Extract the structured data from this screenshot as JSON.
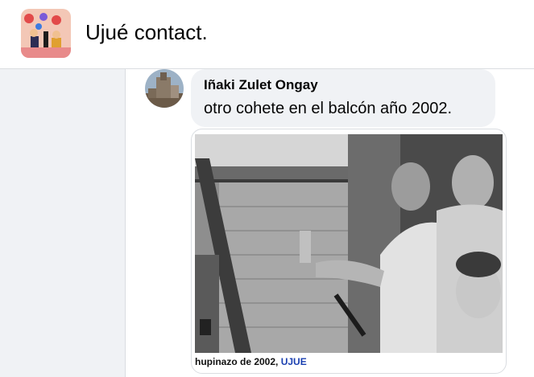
{
  "header": {
    "group_name": "Ujué contact."
  },
  "comment": {
    "author": "Iñaki Zulet Ongay",
    "text": "otro cohete en el balcón año 2002."
  },
  "photo": {
    "caption_prefix": "hupinazo de 2002, ",
    "caption_source": "UJUE"
  }
}
